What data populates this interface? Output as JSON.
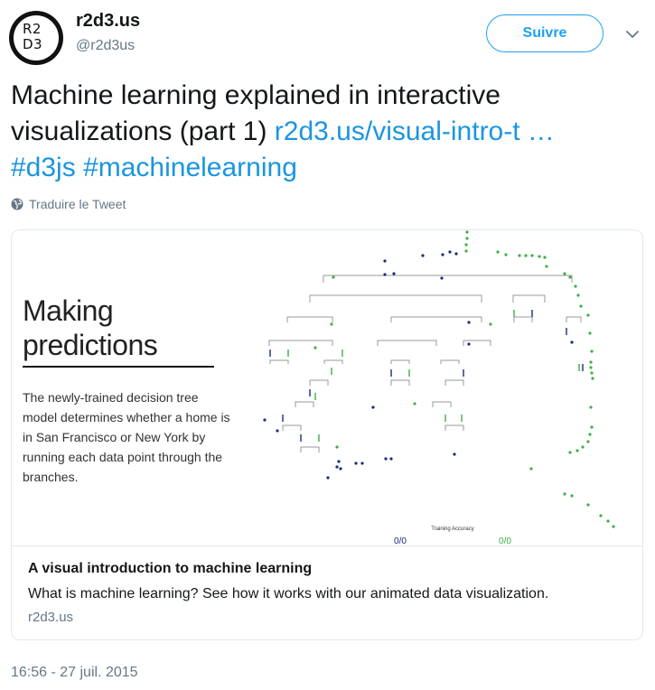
{
  "author": {
    "avatar_text_line1": "R2",
    "avatar_text_line2": "D3",
    "name": "r2d3.us",
    "handle": "@r2d3us"
  },
  "follow_label": "Suivre",
  "tweet": {
    "text": "Machine learning explained in interactive visualizations (part 1) ",
    "link": "r2d3.us/visual-intro-t …",
    "hashtag_1": "#d3js",
    "hashtag_2": "#machinelearning"
  },
  "translate_label": "Traduire le Tweet",
  "card": {
    "image": {
      "title_line1": "Making",
      "title_line2": "predictions",
      "description": "The newly-trained decision tree model determines whether a home is in San Francisco or New York by running each data point through the branches.",
      "accuracy_label": "Training Accuracy",
      "score_left": "0/0",
      "score_right": "0/0"
    },
    "title": "A visual introduction to machine learning",
    "description": "What is machine learning? See how it works with our animated data visualization.",
    "domain": "r2d3.us"
  },
  "timestamp": "16:56 - 27 juil. 2015",
  "colors": {
    "link": "#1b95e0",
    "ny_blue": "#1a2b7a",
    "sf_green": "#3cb043"
  }
}
